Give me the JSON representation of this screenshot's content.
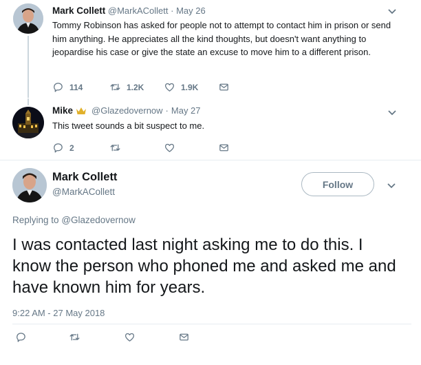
{
  "tweets": [
    {
      "author": "Mark Collett",
      "handle": "@MarkACollett",
      "separator": "·",
      "date": "May 26",
      "text": "Tommy Robinson has asked for people not to attempt to contact him in prison or send him anything. He appreciates all the kind thoughts, but doesn't want anything to jeopardise his case or give the state an excuse to move him to a different prison.",
      "replies": "114",
      "retweets": "1.2K",
      "likes": "1.9K"
    },
    {
      "author": "Mike",
      "handle": "@Glazedovernow",
      "separator": "·",
      "date": "May 27",
      "text": "This tweet sounds a bit suspect to me.",
      "replies": "2",
      "retweets": "",
      "likes": ""
    }
  ],
  "main": {
    "author": "Mark Collett",
    "handle": "@MarkACollett",
    "follow_label": "Follow",
    "replying_to_label": "Replying to",
    "replying_to_handle": "@Glazedovernow",
    "text": "I was contacted last night asking me to do this. I know the person who phoned me and asked me and have known him for years.",
    "timestamp": "9:22 AM - 27 May 2018"
  },
  "icons": {
    "reply": "reply-icon",
    "retweet": "retweet-icon",
    "like": "heart-icon",
    "dm": "envelope-icon",
    "more": "chevron-down-icon",
    "badge": "crown-emoji-icon"
  },
  "colors": {
    "text": "#14171a",
    "muted": "#657786",
    "link": "#657786",
    "divider": "#e6ecf0",
    "badge": "#e1b12c"
  }
}
